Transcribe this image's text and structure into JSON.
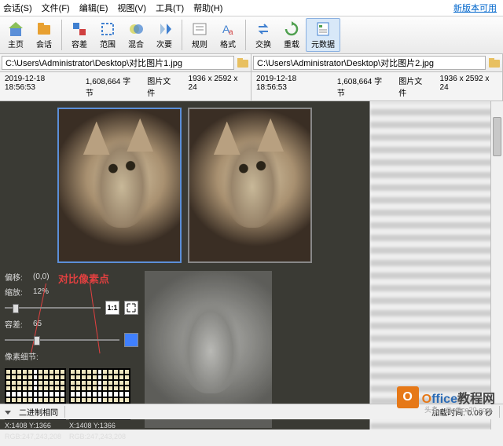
{
  "menu": {
    "items": [
      "会话(S)",
      "文件(F)",
      "编辑(E)",
      "视图(V)",
      "工具(T)",
      "帮助(H)"
    ],
    "update": "新版本可用"
  },
  "toolbar": {
    "home": "主页",
    "sessions": "会话",
    "tolerance": "容差",
    "range": "范围",
    "blend": "混合",
    "next": "次要",
    "rules": "规则",
    "format": "格式",
    "swap": "交换",
    "reload": "重载",
    "metadata": "元数据"
  },
  "paths": {
    "left": "C:\\Users\\Administrator\\Desktop\\对比图片1.jpg",
    "right": "C:\\Users\\Administrator\\Desktop\\对比图片2.jpg"
  },
  "info": {
    "left": {
      "date": "2019-12-18 18:56:53",
      "size": "1,608,664 字节",
      "type": "图片文件",
      "dim": "1936 x 2592 x 24"
    },
    "right": {
      "date": "2019-12-18 18:56:53",
      "size": "1,608,664 字节",
      "type": "图片文件",
      "dim": "1936 x 2592 x 24"
    }
  },
  "controls": {
    "offset_label": "偏移:",
    "offset_val": "(0,0)",
    "zoom_label": "缩放:",
    "zoom_val": "12%",
    "tol_label": "容差:",
    "tol_val": "65",
    "detail_label": "像素细节:",
    "btn_11": "1:1",
    "annotation": "对比像素点"
  },
  "pixel": {
    "left": {
      "xy": "X:1408 Y:1366",
      "rgb": "RGB:247,243,208"
    },
    "right": {
      "xy": "X:1408 Y:1366",
      "rgb": "RGB:247,243,208"
    }
  },
  "status": {
    "mode": "二进制相同",
    "timing": "加载时间: 0.09 秒"
  },
  "watermark": {
    "brand1": "O",
    "brand2": "ffice",
    "brand3": "教程网",
    "sub": "头条 - @office20.com"
  }
}
